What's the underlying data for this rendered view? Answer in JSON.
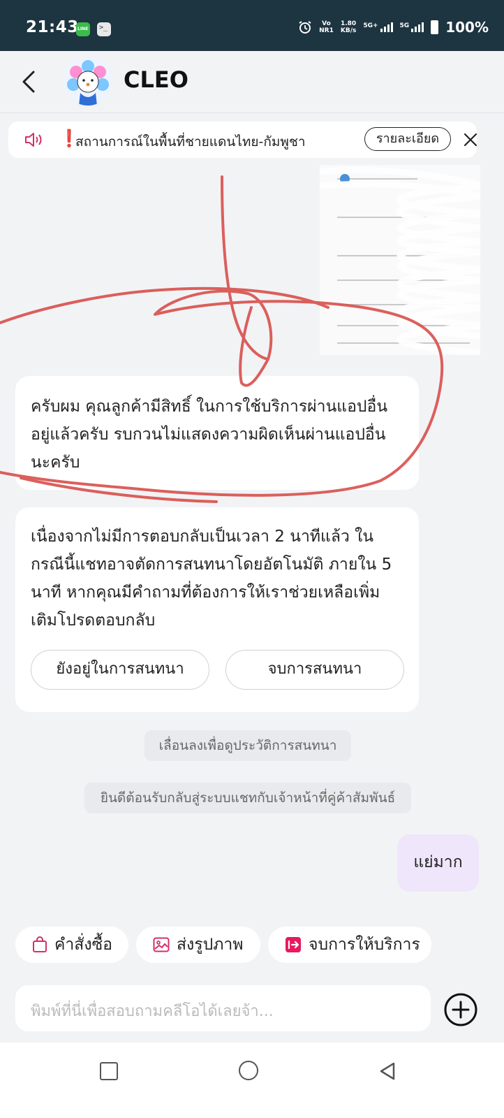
{
  "status_bar": {
    "time": "21:43",
    "network_top": "Vo",
    "network_bottom": "NR1",
    "speed_top": "1.80",
    "speed_bottom": "KB/s",
    "signal1_label": "5G+",
    "signal2_label": "5G",
    "battery": "100%",
    "icons": [
      "line-app-icon",
      "terminal-app-icon",
      "alarm-icon",
      "signal-icon",
      "battery-icon"
    ]
  },
  "header": {
    "title": "CLEO",
    "back_icon": "chevron-left-icon",
    "avatar": "cleo-mascot-avatar"
  },
  "announcement": {
    "text": "สถานการณ์ในพื้นที่ชายแดนไทย-กัมพูชา",
    "detail_button": "รายละเอียด",
    "bang": "❗"
  },
  "messages": {
    "bot_1": "ครับผม คุณลูกค้ามีสิทธิ์ ในการใช้บริการผ่านแอปอื่นอยู่แล้วครับ รบกวนไม่แสดงความผิดเห็นผ่านแอปอื่นนะครับ",
    "bot_2": "เนื่องจากไม่มีการตอบกลับเป็นเวลา 2 นาทีแล้ว ในกรณีนี้แชทอาจตัดการสนทนาโดยอัตโนมัติ ภายใน 5 นาที หากคุณมีคำถามที่ต้องการให้เราช่วยเหลือเพิ่มเติมโปรดตอบกลับ",
    "quick_reply_stay": "ยังอยู่ในการสนทนา",
    "quick_reply_end": "จบการสนทนา",
    "system_scroll": "เลื่อนลงเพื่อดูประวัติการสนทนา",
    "system_welcome": "ยินดีต้อนรับกลับสู่ระบบแชทกับเจ้าหน้าที่คู่ค้าสัมพันธ์",
    "user_1": "แย่มาก"
  },
  "actions": {
    "orders": "คำสั่งซื้อ",
    "send_image": "ส่งรูปภาพ",
    "end_service": "จบการให้บริการ"
  },
  "input": {
    "placeholder": "พิมพ์ที่นี่เพื่อสอบถามคลีโอได้เลยจ้า..."
  },
  "colors": {
    "status_bar": "#1d3441",
    "accent_pink": "#d1306b",
    "user_bubble": "#efe6fb",
    "scribble": "#d9534f"
  }
}
